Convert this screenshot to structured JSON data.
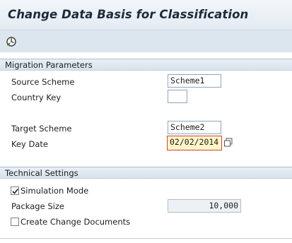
{
  "window": {
    "title": "Change Data Basis for Classification"
  },
  "toolbar": {
    "execute_icon": "execute-clock-icon"
  },
  "migration": {
    "header": "Migration Parameters",
    "source_scheme_label": "Source Scheme",
    "source_scheme_value": "Scheme1",
    "country_key_label": "Country Key",
    "country_key_value": "",
    "target_scheme_label": "Target Scheme",
    "target_scheme_value": "Scheme2",
    "key_date_label": "Key Date",
    "key_date_value": "02/02/2014",
    "key_date_help_icon": "value-help-icon"
  },
  "technical": {
    "header": "Technical Settings",
    "simulation_label": "Simulation Mode",
    "simulation_checked": true,
    "package_size_label": "Package Size",
    "package_size_value": "10,000",
    "change_docs_label": "Create Change Documents",
    "change_docs_checked": false
  }
}
